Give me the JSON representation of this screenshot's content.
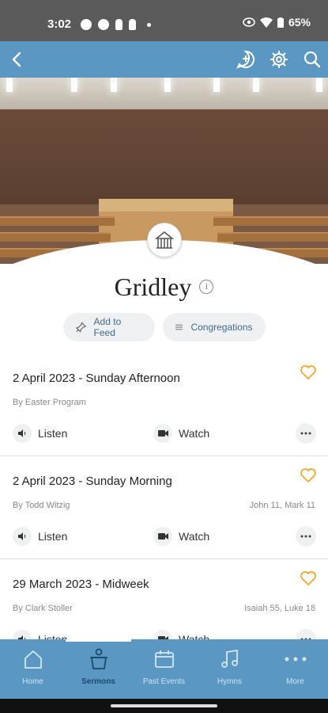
{
  "status_bar": {
    "time": "3:02",
    "battery": "65%"
  },
  "app_bar": {
    "back_icon": "arrow-left-icon",
    "icons": [
      "chat-add-icon",
      "gear-icon",
      "search-icon"
    ]
  },
  "hero": {
    "badge_icon": "church-icon"
  },
  "church": {
    "name": "Gridley"
  },
  "actions": {
    "add_to_feed": "Add to Feed",
    "congregations": "Congregations"
  },
  "sermons": [
    {
      "title": "2 April 2023 - Sunday Afternoon",
      "by": "By Easter Program",
      "refs": "",
      "listen": "Listen",
      "watch": "Watch"
    },
    {
      "title": "2 April 2023 - Sunday Morning",
      "by": "By Todd Witzig",
      "refs": "John 11, Mark 11",
      "listen": "Listen",
      "watch": "Watch"
    },
    {
      "title": "29 March 2023 - Midweek",
      "by": "By Clark Stoller",
      "refs": "Isaiah 55, Luke 18",
      "listen": "Listen",
      "watch": "Watch"
    }
  ],
  "nav": {
    "active": "Sermons",
    "items": [
      {
        "label": "Home",
        "icon": "home-icon"
      },
      {
        "label": "Sermons",
        "icon": "pulpit-icon"
      },
      {
        "label": "Past Events",
        "icon": "calendar-icon"
      },
      {
        "label": "Hymns",
        "icon": "music-note-icon"
      },
      {
        "label": "More",
        "icon": "more-dots-icon"
      }
    ]
  },
  "colors": {
    "primary": "#5b97c3",
    "accent_heart": "#f0a830",
    "active_nav": "#1d4a6e"
  }
}
